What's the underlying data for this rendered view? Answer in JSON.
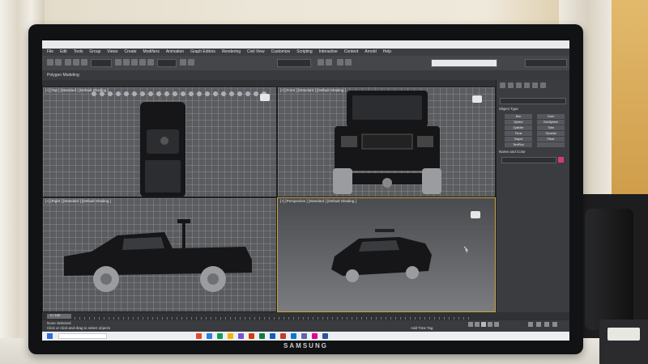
{
  "app": {
    "title": "",
    "menu": [
      "File",
      "Edit",
      "Tools",
      "Group",
      "Views",
      "Create",
      "Modifiers",
      "Animation",
      "Graph Editors",
      "Rendering",
      "Civil View",
      "Customize",
      "Scripting",
      "Interactive",
      "Content",
      "Arnold",
      "Help"
    ],
    "ribbon_label": "Polygon Modeling"
  },
  "viewports": [
    {
      "id": "top",
      "label": "[+] [Top ] [Standard ] [Default Shading ]"
    },
    {
      "id": "front",
      "label": "[+] [Front ] [Standard ] [Default Shading ]"
    },
    {
      "id": "right",
      "label": "[+] [Right ] [Standard ] [Default Shading ]"
    },
    {
      "id": "perspective",
      "label": "[+] [Perspective ] [Standard ] [Default Shading ]"
    }
  ],
  "command_panel": {
    "section1": "Object Type",
    "section2": "Name and Color",
    "buttons": [
      "Box",
      "Cone",
      "Sphere",
      "GeoSphere",
      "Cylinder",
      "Tube",
      "Torus",
      "Pyramid",
      "Teapot",
      "Plane",
      "TextPlus",
      ""
    ]
  },
  "status": {
    "selection": "None Selected",
    "prompt": "Click or click-and-drag to select objects",
    "frame": "0 / 100",
    "time_tag": "Add Time Tag"
  },
  "monitor_brand": "SAMSUNG",
  "taskbar": {
    "icon_colors": [
      "#e04b2c",
      "#2a7de1",
      "#0f9d58",
      "#f4b400",
      "#7b4fd6",
      "#d83b01",
      "#107c41",
      "#185abd",
      "#c43e1c",
      "#0078d4",
      "#6264a7",
      "#e3008c",
      "#2b579a"
    ]
  }
}
